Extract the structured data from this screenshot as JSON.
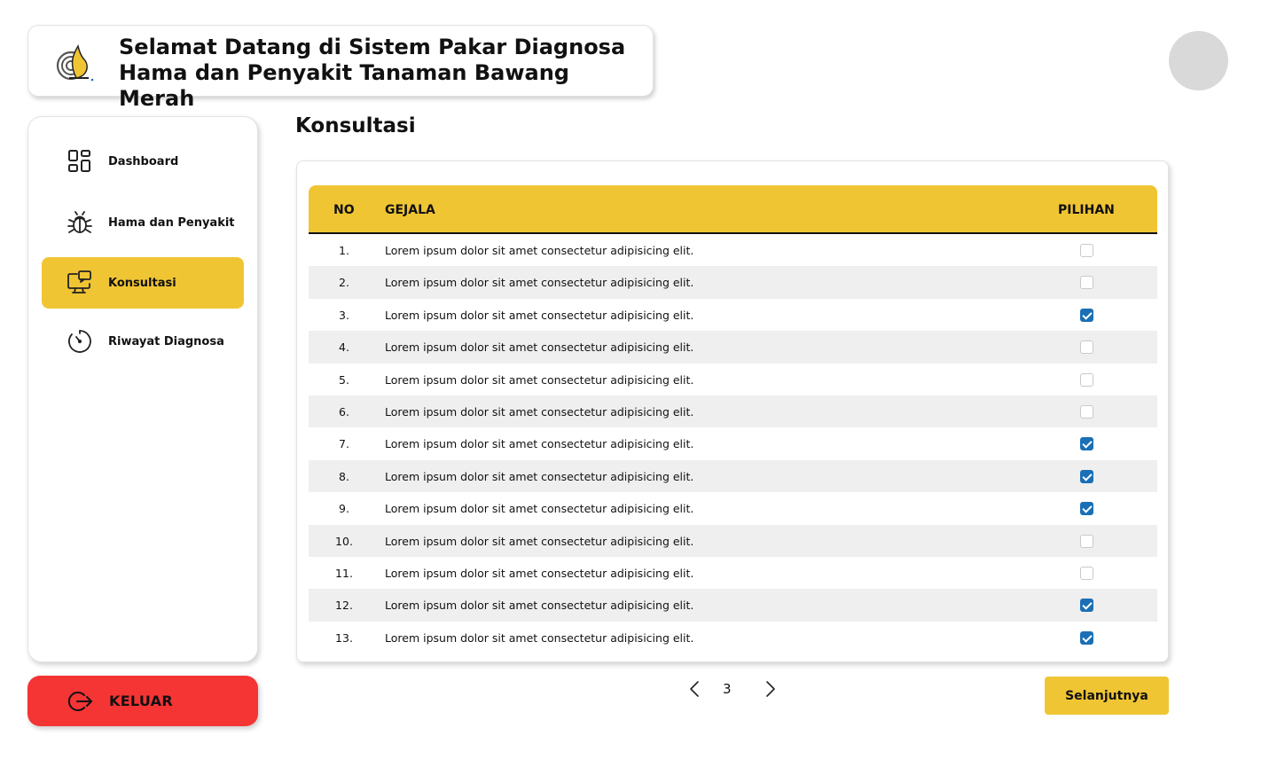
{
  "header": {
    "title": "Selamat Datang di Sistem Pakar Diagnosa Hama dan Penyakit Tanaman Bawang Merah"
  },
  "sidebar": {
    "items": [
      {
        "label": "Dashboard",
        "icon": "dashboard-grid-icon",
        "active": false
      },
      {
        "label": "Hama dan Penyakit",
        "icon": "bug-icon",
        "active": false
      },
      {
        "label": "Konsultasi",
        "icon": "monitor-chat-icon",
        "active": true
      },
      {
        "label": "Riwayat Diagnosa",
        "icon": "history-clock-icon",
        "active": false
      }
    ],
    "logout_label": "KELUAR"
  },
  "main": {
    "title": "Konsultasi",
    "table": {
      "headers": {
        "no": "NO",
        "gejala": "GEJALA",
        "pilihan": "PILIHAN"
      },
      "rows": [
        {
          "no": "1.",
          "gejala": "Lorem ipsum dolor sit amet consectetur adipisicing elit.",
          "checked": false
        },
        {
          "no": "2.",
          "gejala": "Lorem ipsum dolor sit amet consectetur adipisicing elit.",
          "checked": false
        },
        {
          "no": "3.",
          "gejala": "Lorem ipsum dolor sit amet consectetur adipisicing elit.",
          "checked": true
        },
        {
          "no": "4.",
          "gejala": "Lorem ipsum dolor sit amet consectetur adipisicing elit.",
          "checked": false
        },
        {
          "no": "5.",
          "gejala": "Lorem ipsum dolor sit amet consectetur adipisicing elit.",
          "checked": false
        },
        {
          "no": "6.",
          "gejala": "Lorem ipsum dolor sit amet consectetur adipisicing elit.",
          "checked": false
        },
        {
          "no": "7.",
          "gejala": "Lorem ipsum dolor sit amet consectetur adipisicing elit.",
          "checked": true
        },
        {
          "no": "8.",
          "gejala": "Lorem ipsum dolor sit amet consectetur adipisicing elit.",
          "checked": true
        },
        {
          "no": "9.",
          "gejala": "Lorem ipsum dolor sit amet consectetur adipisicing elit.",
          "checked": true
        },
        {
          "no": "10.",
          "gejala": "Lorem ipsum dolor sit amet consectetur adipisicing elit.",
          "checked": false
        },
        {
          "no": "11.",
          "gejala": "Lorem ipsum dolor sit amet consectetur adipisicing elit.",
          "checked": false
        },
        {
          "no": "12.",
          "gejala": "Lorem ipsum dolor sit amet consectetur adipisicing elit.",
          "checked": true
        },
        {
          "no": "13.",
          "gejala": "Lorem ipsum dolor sit amet consectetur adipisicing elit.",
          "checked": true
        }
      ]
    },
    "pagination": {
      "current_page": "3",
      "prev_icon": "chevron-left-icon",
      "next_icon": "chevron-right-icon"
    },
    "next_button_label": "Selanjutnya"
  },
  "colors": {
    "accent": "#f0c534",
    "logout": "#f53434",
    "checkbox_checked": "#1a6fb5",
    "row_alt": "#efefef"
  }
}
